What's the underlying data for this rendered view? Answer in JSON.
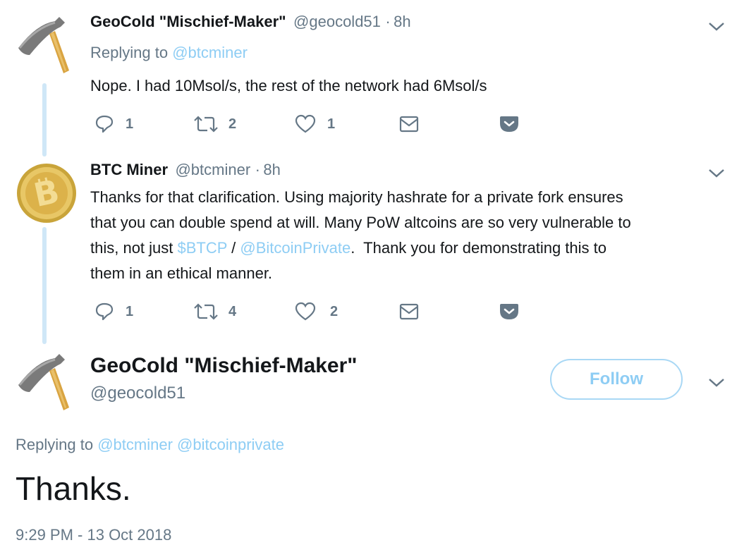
{
  "reply1": {
    "name": "GeoCold \"Mischief-Maker\"",
    "handle": "@geocold51",
    "sep": "·",
    "time": "8h",
    "replying_prefix": "Replying to",
    "replying_to": "@btcminer",
    "text": "Nope. I had 10Msol/s, the rest of the network had 6Msol/s",
    "replies": "1",
    "retweets": "2",
    "likes": "1"
  },
  "reply2": {
    "name": "BTC Miner",
    "handle": "@btcminer",
    "sep": "·",
    "time": "8h",
    "text_line1": "Thanks for that clarification.  Using majority hashrate for a private fork ensures",
    "text_line2": "that you can double spend at will. Many PoW altcoins are so very vulnerable to",
    "text_line3_pre": "this, not just ",
    "cashtag": "$BTCP",
    "text_line3_mid": " / ",
    "mention": "@BitcoinPrivate",
    "text_line3_post": ".  Thank you for demonstrating this to",
    "text_line4": "them in an ethical manner.",
    "replies": "1",
    "retweets": "4",
    "likes": "2"
  },
  "main": {
    "name": "GeoCold \"Mischief-Maker\"",
    "handle": "@geocold51",
    "follow_label": "Follow",
    "replying_prefix": "Replying to",
    "replying_to_1": "@btcminer",
    "replying_to_2": "@bitcoinprivate",
    "text": "Thanks.",
    "timestamp": "9:29 PM - 13 Oct 2018"
  },
  "colors": {
    "link": "#8ecdf4",
    "muted": "#657786",
    "thread_line": "#cfe7f7"
  },
  "icons": [
    "pickaxe-icon",
    "bitcoin-icon",
    "reply-icon",
    "retweet-icon",
    "heart-icon",
    "envelope-icon",
    "pocket-icon",
    "chevron-down-icon"
  ]
}
